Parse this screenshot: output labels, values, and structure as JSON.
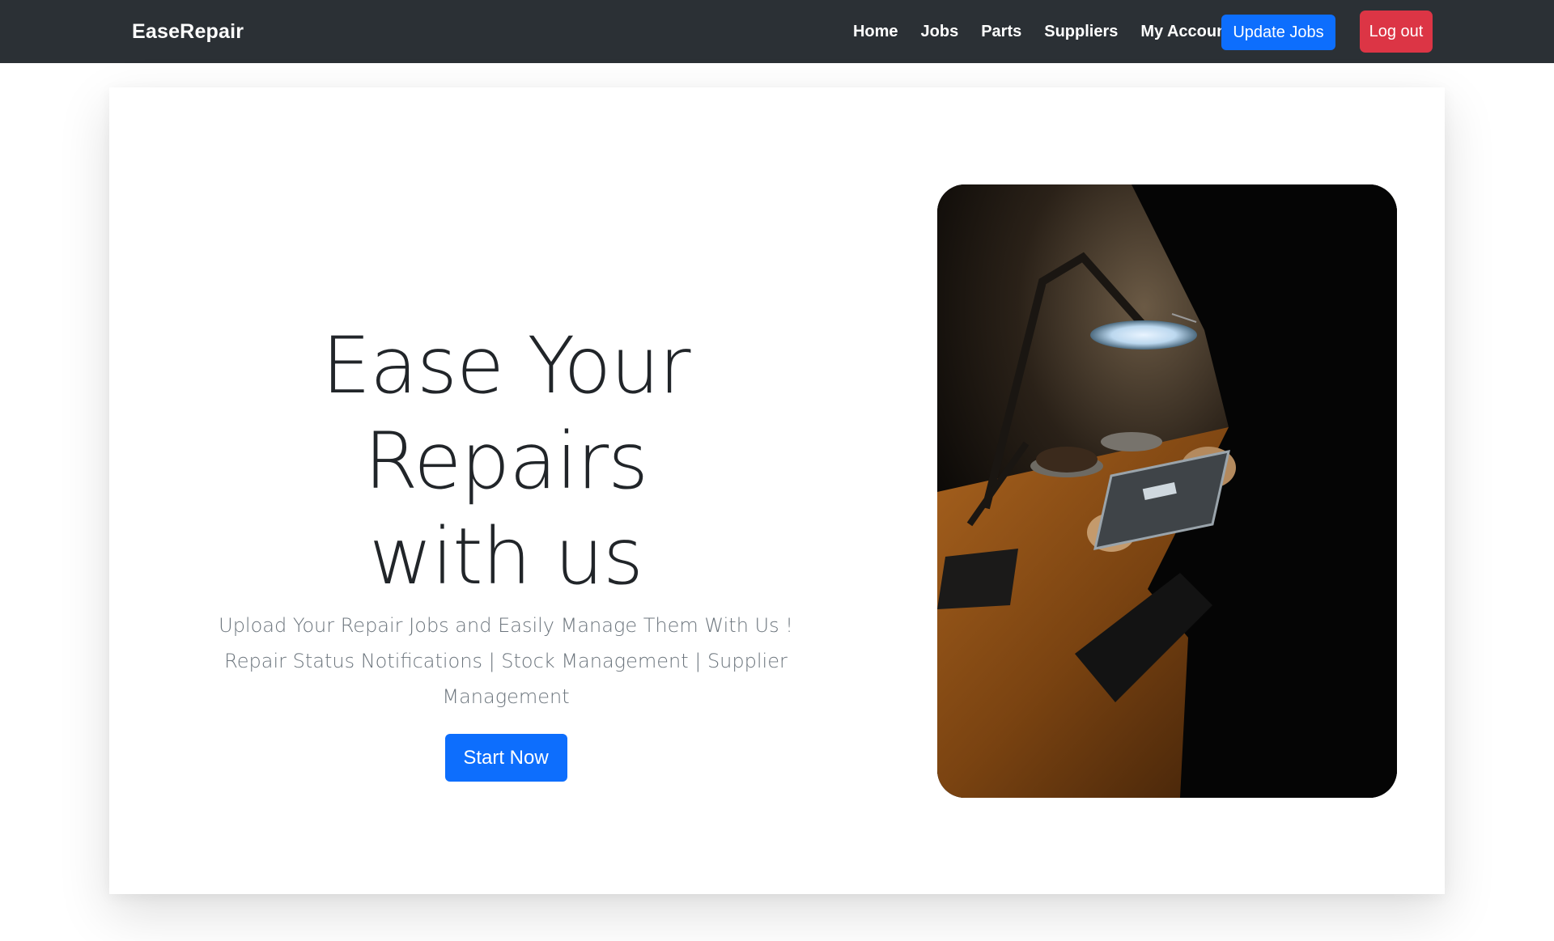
{
  "navbar": {
    "brand": "EaseRepair",
    "links": [
      "Home",
      "Jobs",
      "Parts",
      "Suppliers",
      "My Account"
    ],
    "update_jobs_label": "Update Jobs",
    "logout_label": "Log out"
  },
  "hero": {
    "title_line1": "Ease Your Repairs",
    "title_line2": "with us",
    "subtitle1": "Upload Your Repair Jobs and Easily Manage Them With Us !",
    "subtitle2": "Repair Status Notifications | Stock Management | Supplier Management",
    "cta_label": "Start Now",
    "image_icon": "phone-repair-photo"
  },
  "colors": {
    "navbar_bg": "#2b3035",
    "primary": "#0d6efd",
    "danger": "#dc3545",
    "title": "#212529",
    "muted": "#6c757d"
  }
}
